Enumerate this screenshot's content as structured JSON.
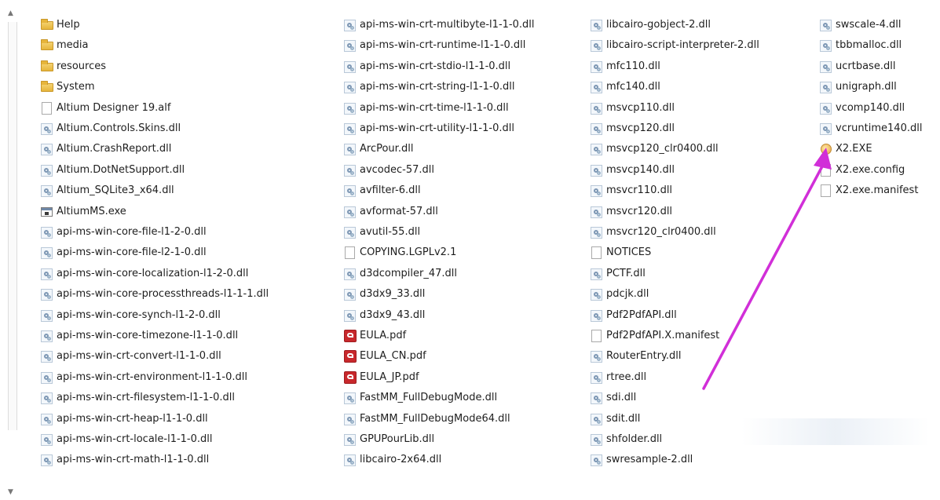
{
  "explorer": {
    "columns": [
      {
        "items": [
          {
            "name": "Help",
            "icon": "folder-icon"
          },
          {
            "name": "media",
            "icon": "folder-icon"
          },
          {
            "name": "resources",
            "icon": "folder-icon"
          },
          {
            "name": "System",
            "icon": "folder-icon"
          },
          {
            "name": "Altium Designer 19.alf",
            "icon": "file-icon"
          },
          {
            "name": "Altium.Controls.Skins.dll",
            "icon": "dll-icon"
          },
          {
            "name": "Altium.CrashReport.dll",
            "icon": "dll-icon"
          },
          {
            "name": "Altium.DotNetSupport.dll",
            "icon": "dll-icon"
          },
          {
            "name": "Altium_SQLite3_x64.dll",
            "icon": "dll-icon"
          },
          {
            "name": "AltiumMS.exe",
            "icon": "exe-icon"
          },
          {
            "name": "api-ms-win-core-file-l1-2-0.dll",
            "icon": "dll-icon"
          },
          {
            "name": "api-ms-win-core-file-l2-1-0.dll",
            "icon": "dll-icon"
          },
          {
            "name": "api-ms-win-core-localization-l1-2-0.dll",
            "icon": "dll-icon"
          },
          {
            "name": "api-ms-win-core-processthreads-l1-1-1.dll",
            "icon": "dll-icon"
          },
          {
            "name": "api-ms-win-core-synch-l1-2-0.dll",
            "icon": "dll-icon"
          },
          {
            "name": "api-ms-win-core-timezone-l1-1-0.dll",
            "icon": "dll-icon"
          },
          {
            "name": "api-ms-win-crt-convert-l1-1-0.dll",
            "icon": "dll-icon"
          },
          {
            "name": "api-ms-win-crt-environment-l1-1-0.dll",
            "icon": "dll-icon"
          },
          {
            "name": "api-ms-win-crt-filesystem-l1-1-0.dll",
            "icon": "dll-icon"
          },
          {
            "name": "api-ms-win-crt-heap-l1-1-0.dll",
            "icon": "dll-icon"
          },
          {
            "name": "api-ms-win-crt-locale-l1-1-0.dll",
            "icon": "dll-icon"
          },
          {
            "name": "api-ms-win-crt-math-l1-1-0.dll",
            "icon": "dll-icon"
          }
        ]
      },
      {
        "items": [
          {
            "name": "api-ms-win-crt-multibyte-l1-1-0.dll",
            "icon": "dll-icon"
          },
          {
            "name": "api-ms-win-crt-runtime-l1-1-0.dll",
            "icon": "dll-icon"
          },
          {
            "name": "api-ms-win-crt-stdio-l1-1-0.dll",
            "icon": "dll-icon"
          },
          {
            "name": "api-ms-win-crt-string-l1-1-0.dll",
            "icon": "dll-icon"
          },
          {
            "name": "api-ms-win-crt-time-l1-1-0.dll",
            "icon": "dll-icon"
          },
          {
            "name": "api-ms-win-crt-utility-l1-1-0.dll",
            "icon": "dll-icon"
          },
          {
            "name": "ArcPour.dll",
            "icon": "dll-icon"
          },
          {
            "name": "avcodec-57.dll",
            "icon": "dll-icon"
          },
          {
            "name": "avfilter-6.dll",
            "icon": "dll-icon"
          },
          {
            "name": "avformat-57.dll",
            "icon": "dll-icon"
          },
          {
            "name": "avutil-55.dll",
            "icon": "dll-icon"
          },
          {
            "name": "COPYING.LGPLv2.1",
            "icon": "file-icon"
          },
          {
            "name": "d3dcompiler_47.dll",
            "icon": "dll-icon"
          },
          {
            "name": "d3dx9_33.dll",
            "icon": "dll-icon"
          },
          {
            "name": "d3dx9_43.dll",
            "icon": "dll-icon"
          },
          {
            "name": "EULA.pdf",
            "icon": "pdf-icon"
          },
          {
            "name": "EULA_CN.pdf",
            "icon": "pdf-icon"
          },
          {
            "name": "EULA_JP.pdf",
            "icon": "pdf-icon"
          },
          {
            "name": "FastMM_FullDebugMode.dll",
            "icon": "dll-icon"
          },
          {
            "name": "FastMM_FullDebugMode64.dll",
            "icon": "dll-icon"
          },
          {
            "name": "GPUPourLib.dll",
            "icon": "dll-icon"
          },
          {
            "name": "libcairo-2x64.dll",
            "icon": "dll-icon"
          }
        ]
      },
      {
        "items": [
          {
            "name": "libcairo-gobject-2.dll",
            "icon": "dll-icon"
          },
          {
            "name": "libcairo-script-interpreter-2.dll",
            "icon": "dll-icon"
          },
          {
            "name": "mfc110.dll",
            "icon": "dll-icon"
          },
          {
            "name": "mfc140.dll",
            "icon": "dll-icon"
          },
          {
            "name": "msvcp110.dll",
            "icon": "dll-icon"
          },
          {
            "name": "msvcp120.dll",
            "icon": "dll-icon"
          },
          {
            "name": "msvcp120_clr0400.dll",
            "icon": "dll-icon"
          },
          {
            "name": "msvcp140.dll",
            "icon": "dll-icon"
          },
          {
            "name": "msvcr110.dll",
            "icon": "dll-icon"
          },
          {
            "name": "msvcr120.dll",
            "icon": "dll-icon"
          },
          {
            "name": "msvcr120_clr0400.dll",
            "icon": "dll-icon"
          },
          {
            "name": "NOTICES",
            "icon": "file-icon"
          },
          {
            "name": "PCTF.dll",
            "icon": "dll-icon"
          },
          {
            "name": "pdcjk.dll",
            "icon": "dll-icon"
          },
          {
            "name": "Pdf2PdfAPI.dll",
            "icon": "dll-icon"
          },
          {
            "name": "Pdf2PdfAPI.X.manifest",
            "icon": "file-icon"
          },
          {
            "name": "RouterEntry.dll",
            "icon": "dll-icon"
          },
          {
            "name": "rtree.dll",
            "icon": "dll-icon"
          },
          {
            "name": "sdi.dll",
            "icon": "dll-icon"
          },
          {
            "name": "sdit.dll",
            "icon": "dll-icon"
          },
          {
            "name": "shfolder.dll",
            "icon": "dll-icon"
          },
          {
            "name": "swresample-2.dll",
            "icon": "dll-icon"
          }
        ]
      },
      {
        "items": [
          {
            "name": "swscale-4.dll",
            "icon": "dll-icon"
          },
          {
            "name": "tbbmalloc.dll",
            "icon": "dll-icon"
          },
          {
            "name": "ucrtbase.dll",
            "icon": "dll-icon"
          },
          {
            "name": "unigraph.dll",
            "icon": "dll-icon"
          },
          {
            "name": "vcomp140.dll",
            "icon": "dll-icon"
          },
          {
            "name": "vcruntime140.dll",
            "icon": "dll-icon"
          },
          {
            "name": "X2.EXE",
            "icon": "x2-app-icon"
          },
          {
            "name": "X2.exe.config",
            "icon": "file-icon"
          },
          {
            "name": "X2.exe.manifest",
            "icon": "file-icon"
          }
        ]
      }
    ]
  },
  "annotation": {
    "arrow_color": "#d12fd8",
    "points_to": "X2.EXE"
  }
}
